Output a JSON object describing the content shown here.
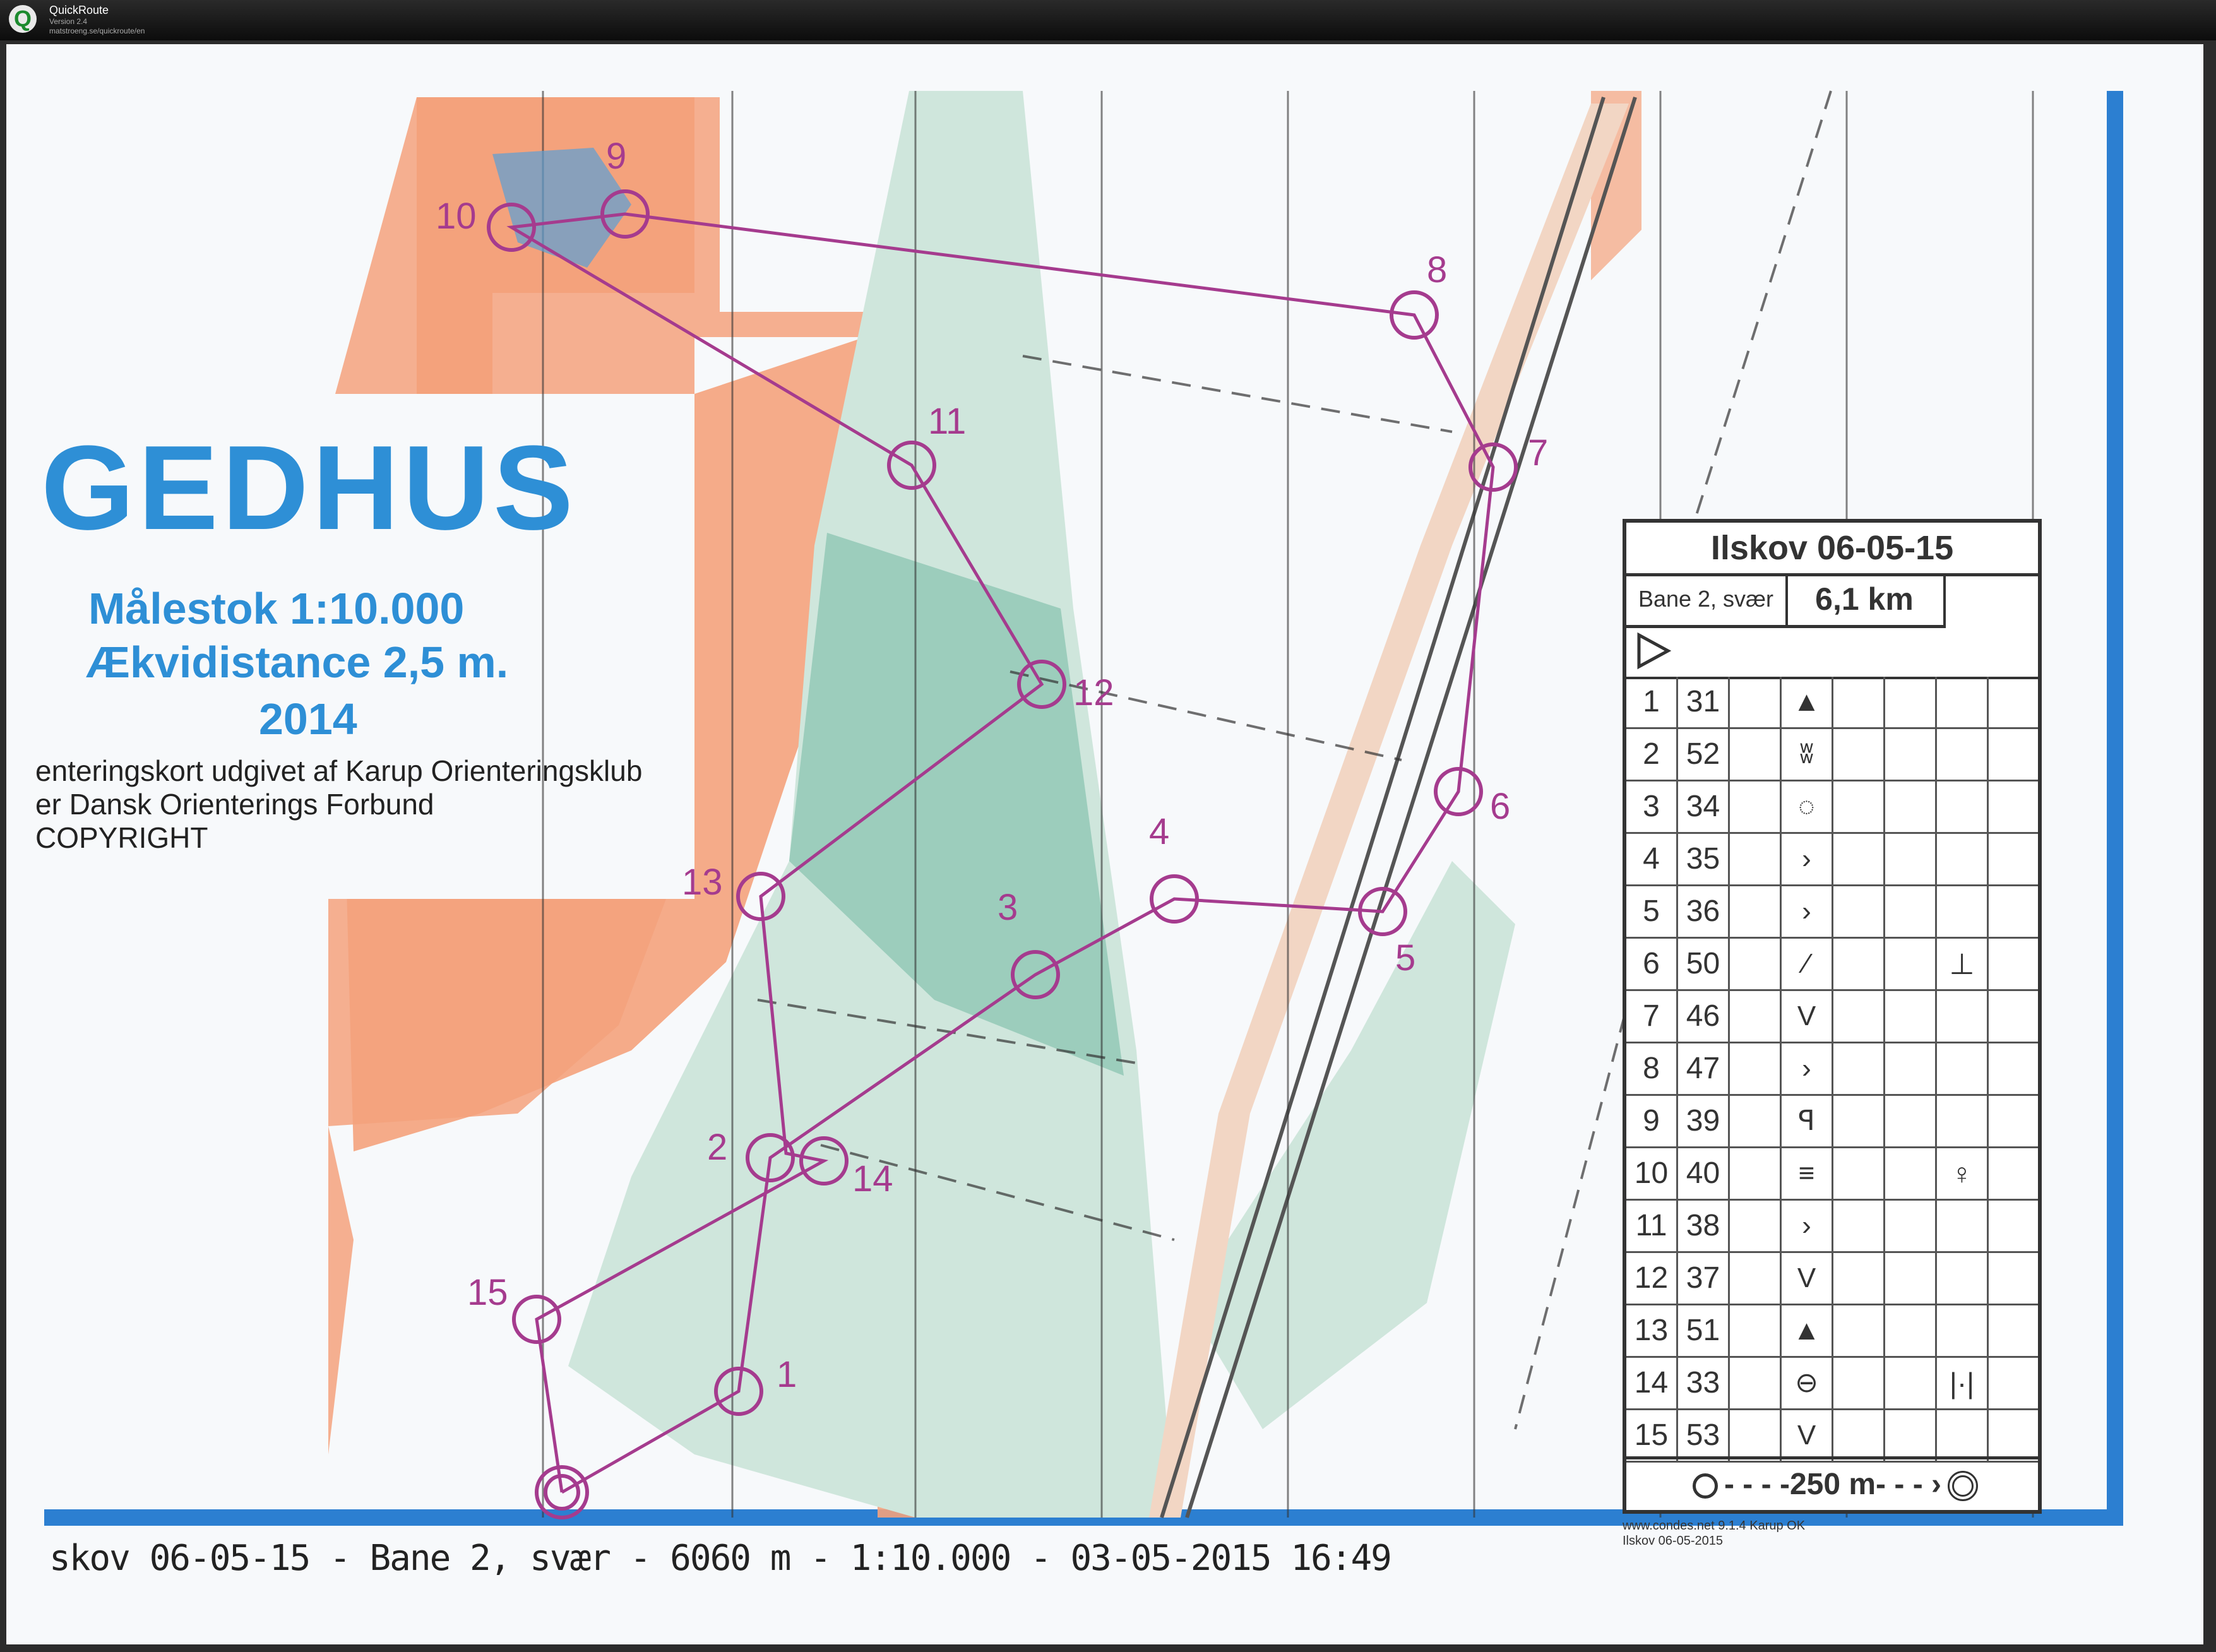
{
  "app": {
    "name": "QuickRoute",
    "version": "Version 2.4",
    "url": "matstroeng.se/quickroute/en"
  },
  "map": {
    "title": "GEDHUS",
    "scale": "Målestok 1:10.000",
    "contour": "Ækvidistance 2,5 m.",
    "year": "2014",
    "publisher_line1": "enteringskort udgivet af Karup Orienteringsklub",
    "publisher_line2": "er Dansk Orienterings Forbund",
    "copyright": "COPYRIGHT",
    "footer": "skov 06-05-15 - Bane 2, svær - 6060 m - 1:10.000 - 03-05-2015 16:49",
    "printer_line1": "www.condes.net 9.1.4 Karup OK",
    "printer_line2": "Ilskov 06-05-2015"
  },
  "colors": {
    "course_purple": "#a53b8e",
    "title_blue": "#2e8fd6",
    "open_land": "#f4a27c",
    "forest_green": "#8fc7b4",
    "border_blue": "#2c7fd1"
  },
  "description_sheet": {
    "event": "Ilskov 06-05-15",
    "course": "Bane 2, svær",
    "length": "6,1 km",
    "start_symbol": "start-triangle-icon",
    "legend": "250 m",
    "rows": [
      {
        "num": "1",
        "code": "31",
        "sym": "▲",
        "extra": ""
      },
      {
        "num": "2",
        "code": "52",
        "sym": "ʬ",
        "extra": ""
      },
      {
        "num": "3",
        "code": "34",
        "sym": "◌",
        "extra": ""
      },
      {
        "num": "4",
        "code": "35",
        "sym": "›",
        "extra": ""
      },
      {
        "num": "5",
        "code": "36",
        "sym": "›",
        "extra": ""
      },
      {
        "num": "6",
        "code": "50",
        "sym": "⁄",
        "extra": "⊥"
      },
      {
        "num": "7",
        "code": "46",
        "sym": "V",
        "extra": ""
      },
      {
        "num": "8",
        "code": "47",
        "sym": "›",
        "extra": ""
      },
      {
        "num": "9",
        "code": "39",
        "sym": "ꟼ",
        "extra": ""
      },
      {
        "num": "10",
        "code": "40",
        "sym": "≡",
        "extra": "♀"
      },
      {
        "num": "11",
        "code": "38",
        "sym": "›",
        "extra": ""
      },
      {
        "num": "12",
        "code": "37",
        "sym": "V",
        "extra": ""
      },
      {
        "num": "13",
        "code": "51",
        "sym": "▲",
        "extra": ""
      },
      {
        "num": "14",
        "code": "33",
        "sym": "⊖",
        "extra": "|·|"
      },
      {
        "num": "15",
        "code": "53",
        "sym": "V",
        "extra": ""
      }
    ]
  },
  "controls": [
    {
      "label": "1"
    },
    {
      "label": "2"
    },
    {
      "label": "3"
    },
    {
      "label": "4"
    },
    {
      "label": "5"
    },
    {
      "label": "6"
    },
    {
      "label": "7"
    },
    {
      "label": "8"
    },
    {
      "label": "9"
    },
    {
      "label": "10"
    },
    {
      "label": "11"
    },
    {
      "label": "12"
    },
    {
      "label": "13"
    },
    {
      "label": "14"
    },
    {
      "label": "15"
    }
  ]
}
